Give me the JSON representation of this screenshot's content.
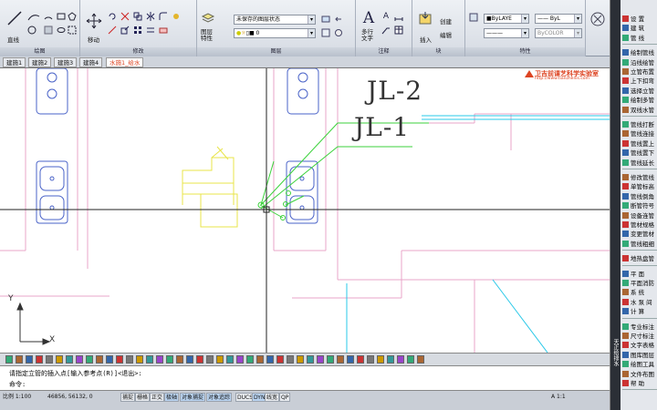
{
  "ribbon": {
    "panels": {
      "draw": "绘图",
      "modify": "修改",
      "layers": "图层",
      "annotation": "注释",
      "block": "块",
      "properties": "特性"
    },
    "line_label": "直线",
    "move_label": "移动",
    "layer_props_label": "图层\n特性",
    "layer_state_value": "未保存的图层状态",
    "layer_current_value": "0",
    "mtext_label": "多行\n文字",
    "insert_label": "插入",
    "create_label": "创建",
    "edit_label": "编辑",
    "color_value": "ByLAYE",
    "linetype_value": "ByL",
    "lineweight_value": "ByCOLOR"
  },
  "tabs": [
    {
      "label": "建施1"
    },
    {
      "label": "建施2"
    },
    {
      "label": "建施3"
    },
    {
      "label": "建施4"
    },
    {
      "label": "水施1_给水"
    }
  ],
  "drawing": {
    "label_jl2": "JL-2",
    "label_jl1": "JL-1",
    "watermark": "卫吉前课艺科学实验室",
    "watermark_url": "http://www.tianzhenis.com",
    "ucs_x": "X",
    "ucs_y": "Y"
  },
  "command": {
    "line1": "请指定立管的插入点[输入参考点(R)]<退出>:",
    "line2": "命令:"
  },
  "status": {
    "scale": "比例 1:100",
    "coords": "46856, 56132, 0",
    "toggles": [
      "捕捉",
      "栅格",
      "正交",
      "极轴",
      "对象捕捉",
      "对象追踪",
      "DUCS",
      "DYN",
      "线宽",
      "QP"
    ],
    "annotation_scale": "A 1:1"
  },
  "palette": {
    "title_vertical": "天正给排水",
    "groups": [
      [
        "设 置",
        "建 筑",
        "管 线"
      ],
      [
        "绘制管线",
        "沿线绘管",
        "立管布置",
        "上下扣弯",
        "选择立管",
        "绘制多管",
        "双线水管"
      ],
      [
        "管线打断",
        "管线连接",
        "管线置上",
        "管线置下",
        "管线延长"
      ],
      [
        "修改管线",
        "单管标高",
        "管线倒角",
        "断管符号",
        "设备连管",
        "管材规格",
        "变更管材",
        "管线粗细"
      ],
      [
        "地热盘管"
      ],
      [
        "平 面",
        "平面消防",
        "系 统",
        "水 泵 间",
        "计 算"
      ],
      [
        "专业标注",
        "尺寸标注",
        "文字表格",
        "图库图层",
        "绘图工具",
        "文件布图",
        "帮 助"
      ]
    ]
  },
  "colors": {
    "green_pipe": "#3bd23b",
    "cyan_pipe": "#29c8e8",
    "pink_wall": "#e8a6c8",
    "yellow": "#e8e44a",
    "blue_fixture": "#4a63c8"
  }
}
